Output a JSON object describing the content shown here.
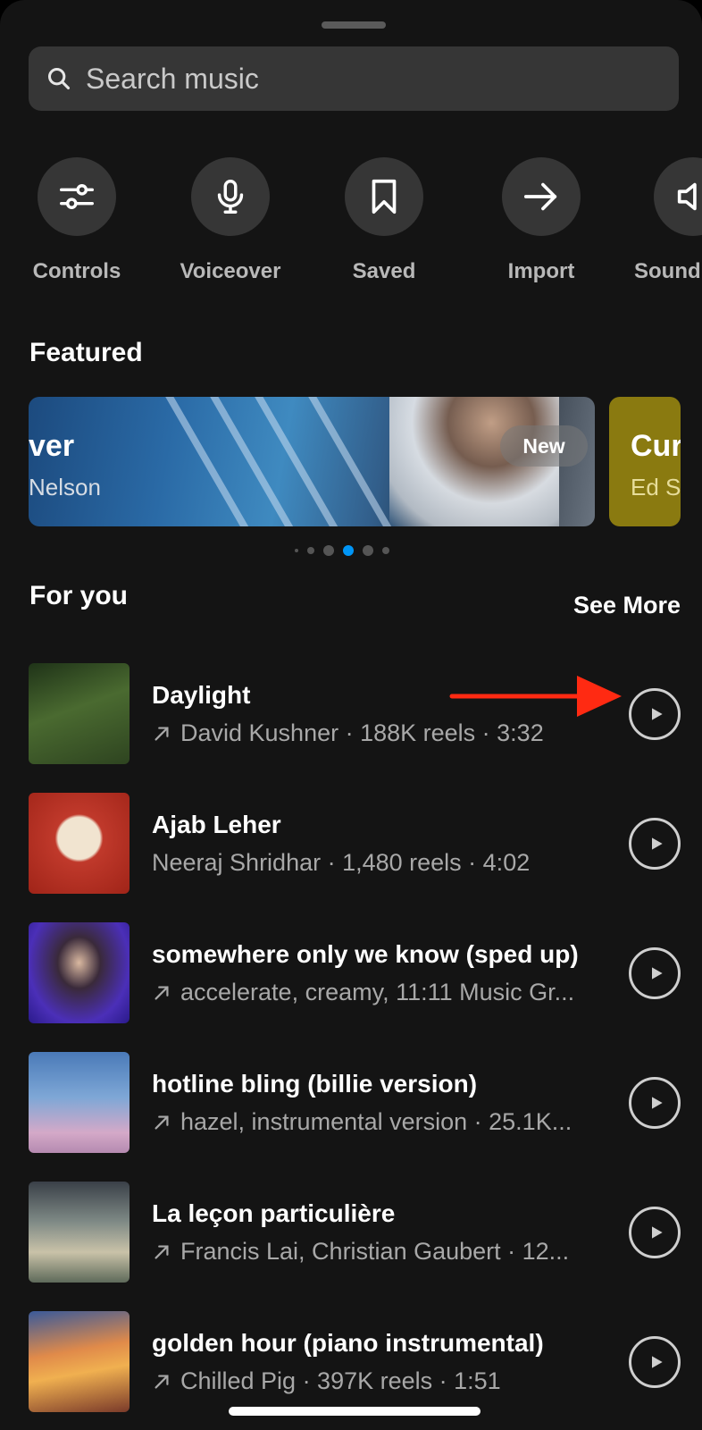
{
  "search": {
    "placeholder": "Search music",
    "icon": "search-icon"
  },
  "actions": [
    {
      "label": "Controls",
      "icon": "sliders-icon"
    },
    {
      "label": "Voiceover",
      "icon": "microphone-icon"
    },
    {
      "label": "Saved",
      "icon": "bookmark-icon"
    },
    {
      "label": "Import",
      "icon": "arrow-right-icon"
    },
    {
      "label": "Sound",
      "icon": "speaker-icon"
    }
  ],
  "featured": {
    "title": "Featured",
    "banners": [
      {
        "title": "ver",
        "artist": "Nelson",
        "badge": "New"
      },
      {
        "title": "Cur",
        "artist": "Ed S"
      }
    ],
    "pager": {
      "count": 6,
      "active": 3
    }
  },
  "for_you": {
    "title": "For you",
    "see_more": "See More",
    "tracks": [
      {
        "name": "Daylight",
        "meta": "David Kushner · 188K reels · 3:32",
        "trending": true,
        "art": "#3e5a2a"
      },
      {
        "name": "Ajab Leher",
        "meta": "Neeraj Shridhar · 1,480 reels · 4:02",
        "trending": false,
        "art": "#c0392b"
      },
      {
        "name": "somewhere only we know (sped up)",
        "meta": "accelerate, creamy, 11:11 Music Gr...",
        "trending": true,
        "art": "#4b2fb8"
      },
      {
        "name": "hotline bling (billie version)",
        "meta": "hazel, instrumental version · 25.1K...",
        "trending": true,
        "art": "#6f95c9"
      },
      {
        "name": "La leçon particulière",
        "meta": "Francis Lai, Christian Gaubert · 12...",
        "trending": true,
        "art": "#8f9a8c"
      },
      {
        "name": "golden hour (piano instrumental)",
        "meta": "Chilled Pig · 397K reels · 1:51",
        "trending": true,
        "art": "#e07a3a"
      }
    ]
  },
  "colors": {
    "background": "#141414",
    "surface": "#363636",
    "accent": "#0095f6",
    "annotation": "#ff2a12"
  }
}
